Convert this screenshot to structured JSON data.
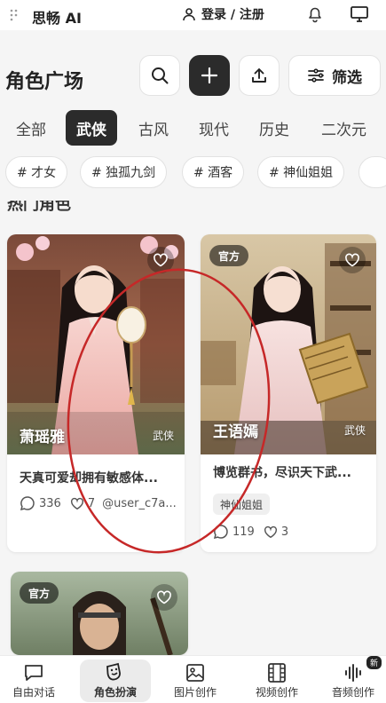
{
  "app": {
    "name": "思畅 AI",
    "login_label": "登录 / 注册"
  },
  "header": {
    "title": "角色广场",
    "filter_label": "筛选"
  },
  "categories": [
    "全部",
    "武侠",
    "古风",
    "现代",
    "历史",
    "二次元"
  ],
  "active_category": "武侠",
  "tags": [
    "# 才女",
    "# 独孤九剑",
    "# 酒客",
    "# 神仙姐姐"
  ],
  "section_peek": "热门角色",
  "cards": [
    {
      "name": "萧瑶雅",
      "genre": "武侠",
      "desc": "天真可爱却拥有敏感体...",
      "comments": "336",
      "likes": "7",
      "author": "@user_c7a...",
      "official": ""
    },
    {
      "name": "王语嫣",
      "genre": "武侠",
      "desc": "博览群书，尽识天下武...",
      "chip": "神仙姐姐",
      "comments": "119",
      "likes": "3",
      "official": "官方"
    },
    {
      "official": "官方"
    }
  ],
  "nav": [
    {
      "label": "自由对话",
      "icon": "chat-icon"
    },
    {
      "label": "角色扮演",
      "icon": "mask-icon"
    },
    {
      "label": "图片创作",
      "icon": "image-icon"
    },
    {
      "label": "视频创作",
      "icon": "film-icon"
    },
    {
      "label": "音频创作",
      "icon": "audio-icon",
      "badge": "新"
    }
  ],
  "colors": {
    "accent_dark": "#2b2b2b",
    "annotation": "#c62828",
    "background": "#f5f5f5"
  }
}
